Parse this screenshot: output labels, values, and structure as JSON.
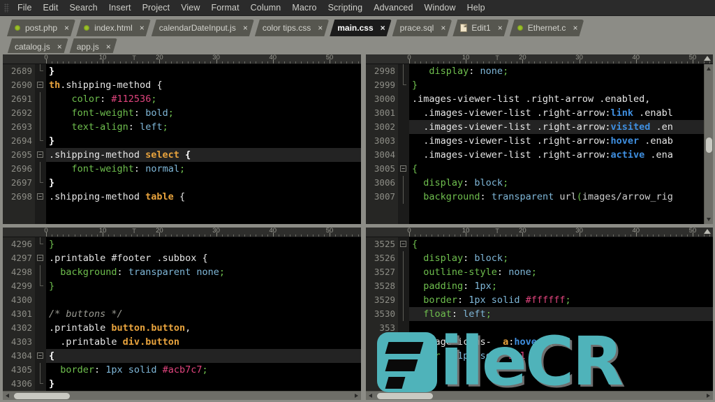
{
  "menubar": {
    "items": [
      {
        "label": "File"
      },
      {
        "label": "Edit"
      },
      {
        "label": "Search"
      },
      {
        "label": "Insert"
      },
      {
        "label": "Project"
      },
      {
        "label": "View"
      },
      {
        "label": "Format"
      },
      {
        "label": "Column"
      },
      {
        "label": "Macro"
      },
      {
        "label": "Scripting"
      },
      {
        "label": "Advanced"
      },
      {
        "label": "Window"
      },
      {
        "label": "Help"
      }
    ]
  },
  "tabs": {
    "row1": [
      {
        "label": "post.php",
        "icon": "green-dot-icon",
        "active": false,
        "close": "×"
      },
      {
        "label": "index.html",
        "icon": "green-dot-icon",
        "active": false,
        "close": "×"
      },
      {
        "label": "calendarDateInput.js",
        "icon": "none",
        "active": false,
        "close": "×"
      },
      {
        "label": "color tips.css",
        "icon": "none",
        "active": false,
        "close": "×"
      },
      {
        "label": "main.css",
        "icon": "none",
        "active": true,
        "close": "×"
      },
      {
        "label": "prace.sql",
        "icon": "none",
        "active": false,
        "close": "×"
      },
      {
        "label": "Edit1",
        "icon": "page-icon",
        "active": false,
        "close": "×"
      },
      {
        "label": "Ethernet.c",
        "icon": "green-dot-icon",
        "active": false,
        "close": "×"
      }
    ],
    "row2": [
      {
        "label": "catalog.js",
        "icon": "none",
        "active": false,
        "close": "×"
      },
      {
        "label": "app.js",
        "icon": "none",
        "active": false,
        "close": "×"
      }
    ]
  },
  "ruler": {
    "numbers": [
      "0",
      "10",
      "20",
      "30",
      "40",
      "50"
    ]
  },
  "colors": {
    "editor_bg": "#000000",
    "gutter_bg": "#262624",
    "highlight_line": "#232323",
    "chrome_bg": "#8c8c86",
    "menubar_bg": "#2b2b2b",
    "tab_inactive": "#56564f",
    "tab_active": "#1b1b1b",
    "accent_tag": "#e8a33d",
    "accent_prop": "#6fbf4e",
    "accent_value": "#7fb7d8",
    "accent_hex": "#e0447d",
    "accent_pseudo": "#3f8fe0",
    "watermark": "#4fb3ba"
  },
  "panes": {
    "top_left": {
      "first_line": 2689,
      "lines": [
        {
          "n": "2689",
          "fold": "end",
          "indent": 0,
          "hl": false,
          "tokens": [
            {
              "t": "}",
              "c": "s-brace"
            }
          ]
        },
        {
          "n": "2690",
          "fold": "open",
          "indent": 0,
          "hl": false,
          "tokens": [
            {
              "t": "th",
              "c": "s-tag"
            },
            {
              "t": ".shipping-method ",
              "c": "s-sel"
            },
            {
              "t": "{",
              "c": "s-punc"
            }
          ]
        },
        {
          "n": "2691",
          "fold": "bar",
          "indent": 0,
          "hl": false,
          "tokens": [
            {
              "t": "    color",
              "c": "s-prop"
            },
            {
              "t": ": ",
              "c": "s-punc"
            },
            {
              "t": "#112536",
              "c": "s-hex"
            },
            {
              "t": ";",
              "c": "s-green"
            }
          ]
        },
        {
          "n": "2692",
          "fold": "bar",
          "indent": 0,
          "hl": false,
          "tokens": [
            {
              "t": "    font-weight",
              "c": "s-prop"
            },
            {
              "t": ": ",
              "c": "s-punc"
            },
            {
              "t": "bold",
              "c": "s-val"
            },
            {
              "t": ";",
              "c": "s-green"
            }
          ]
        },
        {
          "n": "2693",
          "fold": "bar",
          "indent": 0,
          "hl": false,
          "tokens": [
            {
              "t": "    text-align",
              "c": "s-prop"
            },
            {
              "t": ": ",
              "c": "s-punc"
            },
            {
              "t": "left",
              "c": "s-val"
            },
            {
              "t": ";",
              "c": "s-green"
            }
          ]
        },
        {
          "n": "2694",
          "fold": "end",
          "indent": 0,
          "hl": false,
          "tokens": [
            {
              "t": "}",
              "c": "s-brace"
            }
          ]
        },
        {
          "n": "2695",
          "fold": "open",
          "indent": 0,
          "hl": true,
          "tokens": [
            {
              "t": ".shipping-method ",
              "c": "s-sel"
            },
            {
              "t": "select",
              "c": "s-tag"
            },
            {
              "t": " ",
              "c": "s-punc"
            },
            {
              "t": "{",
              "c": "s-brace"
            }
          ]
        },
        {
          "n": "2696",
          "fold": "bar",
          "indent": 0,
          "hl": false,
          "tokens": [
            {
              "t": "    font-weight",
              "c": "s-prop"
            },
            {
              "t": ": ",
              "c": "s-punc"
            },
            {
              "t": "normal",
              "c": "s-val"
            },
            {
              "t": ";",
              "c": "s-green"
            }
          ]
        },
        {
          "n": "2697",
          "fold": "end",
          "indent": 0,
          "hl": false,
          "tokens": [
            {
              "t": "}",
              "c": "s-brace"
            }
          ]
        },
        {
          "n": "2698",
          "fold": "open",
          "indent": 0,
          "hl": false,
          "tokens": [
            {
              "t": ".shipping-method ",
              "c": "s-sel"
            },
            {
              "t": "table",
              "c": "s-tag"
            },
            {
              "t": " ",
              "c": "s-punc"
            },
            {
              "t": "{",
              "c": "s-punc"
            }
          ]
        }
      ]
    },
    "top_right": {
      "first_line": 2998,
      "lines": [
        {
          "n": "2998",
          "fold": "bar",
          "hl": false,
          "tokens": [
            {
              "t": "   display",
              "c": "s-prop"
            },
            {
              "t": ": ",
              "c": "s-punc"
            },
            {
              "t": "none",
              "c": "s-val"
            },
            {
              "t": ";",
              "c": "s-green"
            }
          ]
        },
        {
          "n": "2999",
          "fold": "end",
          "hl": false,
          "tokens": [
            {
              "t": "}",
              "c": "s-green"
            }
          ]
        },
        {
          "n": "3000",
          "fold": "none",
          "hl": false,
          "tokens": [
            {
              "t": ".images-viewer-list .right-arrow .enabled,",
              "c": "s-sel"
            }
          ]
        },
        {
          "n": "3001",
          "fold": "none",
          "hl": false,
          "tokens": [
            {
              "t": "  .images-viewer-list .right-arrow:",
              "c": "s-sel"
            },
            {
              "t": "link",
              "c": "s-pseudo"
            },
            {
              "t": " .enabl",
              "c": "s-sel"
            }
          ]
        },
        {
          "n": "3002",
          "fold": "none",
          "hl": true,
          "tokens": [
            {
              "t": "  .images-viewer-list .right-arrow:",
              "c": "s-sel"
            },
            {
              "t": "visited",
              "c": "s-pseudo"
            },
            {
              "t": " .en",
              "c": "s-sel"
            }
          ]
        },
        {
          "n": "3003",
          "fold": "none",
          "hl": false,
          "tokens": [
            {
              "t": "  .images-viewer-list .right-arrow:",
              "c": "s-sel"
            },
            {
              "t": "hover",
              "c": "s-pseudo"
            },
            {
              "t": " .enab",
              "c": "s-sel"
            }
          ]
        },
        {
          "n": "3004",
          "fold": "none",
          "hl": false,
          "tokens": [
            {
              "t": "  .images-viewer-list .right-arrow:",
              "c": "s-sel"
            },
            {
              "t": "active",
              "c": "s-pseudo"
            },
            {
              "t": " .ena",
              "c": "s-sel"
            }
          ]
        },
        {
          "n": "3005",
          "fold": "open",
          "hl": false,
          "tokens": [
            {
              "t": "{",
              "c": "s-green"
            }
          ]
        },
        {
          "n": "3006",
          "fold": "bar",
          "hl": false,
          "tokens": [
            {
              "t": "  display",
              "c": "s-prop"
            },
            {
              "t": ": ",
              "c": "s-punc"
            },
            {
              "t": "block",
              "c": "s-val"
            },
            {
              "t": ";",
              "c": "s-green"
            }
          ]
        },
        {
          "n": "3007",
          "fold": "bar",
          "hl": false,
          "tokens": [
            {
              "t": "  background",
              "c": "s-prop"
            },
            {
              "t": ": ",
              "c": "s-punc"
            },
            {
              "t": "transparent ",
              "c": "s-val"
            },
            {
              "t": "url",
              "c": "s-url"
            },
            {
              "t": "(",
              "c": "s-green"
            },
            {
              "t": "images/arrow_rig",
              "c": "s-url"
            }
          ]
        }
      ]
    },
    "bottom_left": {
      "first_line": 4296,
      "lines": [
        {
          "n": "4296",
          "fold": "end",
          "hl": false,
          "tokens": [
            {
              "t": "}",
              "c": "s-green"
            }
          ]
        },
        {
          "n": "4297",
          "fold": "open",
          "hl": false,
          "tokens": [
            {
              "t": ".printable #footer .subbox ",
              "c": "s-sel"
            },
            {
              "t": "{",
              "c": "s-punc"
            }
          ]
        },
        {
          "n": "4298",
          "fold": "bar",
          "hl": false,
          "tokens": [
            {
              "t": "  background",
              "c": "s-prop"
            },
            {
              "t": ": ",
              "c": "s-punc"
            },
            {
              "t": "transparent none",
              "c": "s-val"
            },
            {
              "t": ";",
              "c": "s-green"
            }
          ]
        },
        {
          "n": "4299",
          "fold": "end",
          "hl": false,
          "tokens": [
            {
              "t": "}",
              "c": "s-green"
            }
          ]
        },
        {
          "n": "4300",
          "fold": "none",
          "hl": false,
          "tokens": []
        },
        {
          "n": "4301",
          "fold": "none",
          "hl": false,
          "tokens": [
            {
              "t": "/* buttons */",
              "c": "s-comment"
            }
          ]
        },
        {
          "n": "4302",
          "fold": "none",
          "hl": false,
          "tokens": [
            {
              "t": ".printable ",
              "c": "s-sel"
            },
            {
              "t": "button",
              "c": "s-tag"
            },
            {
              "t": ".button",
              "c": "s-tag"
            },
            {
              "t": ",",
              "c": "s-sel"
            }
          ]
        },
        {
          "n": "4303",
          "fold": "none",
          "hl": false,
          "tokens": [
            {
              "t": "  .printable ",
              "c": "s-sel"
            },
            {
              "t": "div",
              "c": "s-tag"
            },
            {
              "t": ".button",
              "c": "s-tag"
            }
          ]
        },
        {
          "n": "4304",
          "fold": "open",
          "hl": true,
          "tokens": [
            {
              "t": "{",
              "c": "s-brace"
            }
          ]
        },
        {
          "n": "4305",
          "fold": "bar",
          "hl": false,
          "tokens": [
            {
              "t": "  border",
              "c": "s-prop"
            },
            {
              "t": ": ",
              "c": "s-punc"
            },
            {
              "t": "1px solid ",
              "c": "s-val"
            },
            {
              "t": "#acb7c7",
              "c": "s-hex"
            },
            {
              "t": ";",
              "c": "s-green"
            }
          ]
        },
        {
          "n": "4306",
          "fold": "end",
          "hl": false,
          "tokens": [
            {
              "t": "}",
              "c": "s-brace"
            }
          ]
        }
      ]
    },
    "bottom_right": {
      "first_line": 3525,
      "lines": [
        {
          "n": "3525",
          "fold": "open",
          "hl": false,
          "tokens": [
            {
              "t": "{",
              "c": "s-green"
            }
          ]
        },
        {
          "n": "3526",
          "fold": "bar",
          "hl": false,
          "tokens": [
            {
              "t": "  display",
              "c": "s-prop"
            },
            {
              "t": ": ",
              "c": "s-punc"
            },
            {
              "t": "block",
              "c": "s-val"
            },
            {
              "t": ";",
              "c": "s-green"
            }
          ]
        },
        {
          "n": "3527",
          "fold": "bar",
          "hl": false,
          "tokens": [
            {
              "t": "  outline-style",
              "c": "s-prop"
            },
            {
              "t": ": ",
              "c": "s-punc"
            },
            {
              "t": "none",
              "c": "s-val"
            },
            {
              "t": ";",
              "c": "s-green"
            }
          ]
        },
        {
          "n": "3528",
          "fold": "bar",
          "hl": false,
          "tokens": [
            {
              "t": "  padding",
              "c": "s-prop"
            },
            {
              "t": ": ",
              "c": "s-punc"
            },
            {
              "t": "1px",
              "c": "s-val"
            },
            {
              "t": ";",
              "c": "s-green"
            }
          ]
        },
        {
          "n": "3529",
          "fold": "bar",
          "hl": false,
          "tokens": [
            {
              "t": "  border",
              "c": "s-prop"
            },
            {
              "t": ": ",
              "c": "s-punc"
            },
            {
              "t": "1px solid ",
              "c": "s-val"
            },
            {
              "t": "#ffffff",
              "c": "s-hex"
            },
            {
              "t": ";",
              "c": "s-green"
            }
          ]
        },
        {
          "n": "3530",
          "fold": "bar",
          "hl": true,
          "tokens": [
            {
              "t": "  float",
              "c": "s-prop"
            },
            {
              "t": ": ",
              "c": "s-punc"
            },
            {
              "t": "left",
              "c": "s-val"
            },
            {
              "t": ";",
              "c": "s-green"
            }
          ]
        },
        {
          "n": "353",
          "fold": "none",
          "hl": false,
          "tokens": []
        },
        {
          "n": "353",
          "fold": "none",
          "hl": false,
          "tokens": [
            {
              "t": "dpimage",
              "c": "s-sel"
            },
            {
              "t": " icons-",
              "c": "s-sel"
            },
            {
              "t": "  ",
              "c": "s-punc"
            },
            {
              "t": "a",
              "c": "s-tag"
            },
            {
              "t": ":",
              "c": "s-punc"
            },
            {
              "t": "hover",
              "c": "s-pseudo"
            },
            {
              "t": " {",
              "c": "s-green"
            }
          ]
        },
        {
          "n": "353",
          "fold": "none",
          "hl": false,
          "tokens": [
            {
              "t": "  bor",
              "c": "s-prop"
            },
            {
              "t": "   1p",
              "c": "s-val"
            },
            {
              "t": "  so",
              "c": "s-val"
            },
            {
              "t": "   541",
              "c": "s-hex"
            }
          ]
        },
        {
          "n": "353",
          "fold": "none",
          "hl": false,
          "tokens": [
            {
              "t": "}",
              "c": "s-green"
            }
          ]
        },
        {
          "n": "353",
          "fold": "none",
          "hl": false,
          "tokens": []
        }
      ]
    }
  },
  "watermark": {
    "text": "ileCR",
    "brand": "FileCR",
    "logo": "filecr-logo-icon"
  }
}
